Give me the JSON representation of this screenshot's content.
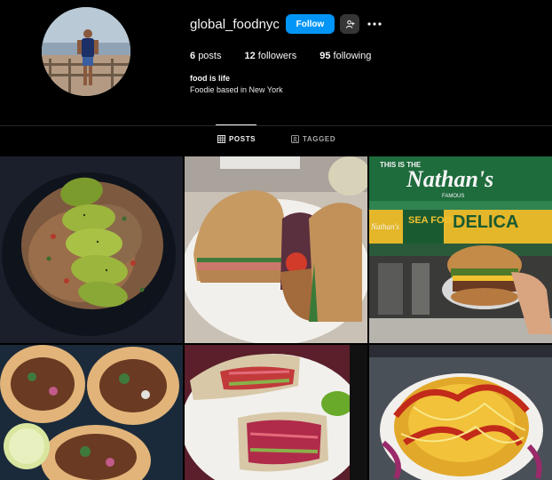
{
  "profile": {
    "username": "global_foodnyc",
    "follow_label": "Follow",
    "suggest_icon": "person-add-icon",
    "more_icon": "more-horizontal-icon",
    "stats": [
      {
        "count": "6",
        "label": "posts"
      },
      {
        "count": "12",
        "label": "followers"
      },
      {
        "count": "95",
        "label": "following"
      }
    ],
    "bio_name": "food is life",
    "bio_text": "Foodie based in New York"
  },
  "tabs": [
    {
      "label": "POSTS",
      "icon": "grid-icon",
      "active": true
    },
    {
      "label": "TAGGED",
      "icon": "tagged-icon",
      "active": false
    }
  ],
  "posts": [
    {
      "subject": "avocado-quinoa-bowl"
    },
    {
      "subject": "sandwiches"
    },
    {
      "subject": "nathans-burger"
    },
    {
      "subject": "tacos"
    },
    {
      "subject": "fish-tacos"
    },
    {
      "subject": "loaded-fries"
    }
  ],
  "photo_text": {
    "sign_top": "THIS IS THE",
    "sign_main": "Nathan's",
    "sign_sub": "FAMOUS",
    "sea_food": "SEA FOOD",
    "delica": "DELICA",
    "nathans_small": "Nathan's"
  },
  "colors": {
    "accent": "#0095f6",
    "background": "#000000",
    "secondary_button": "#363636"
  }
}
